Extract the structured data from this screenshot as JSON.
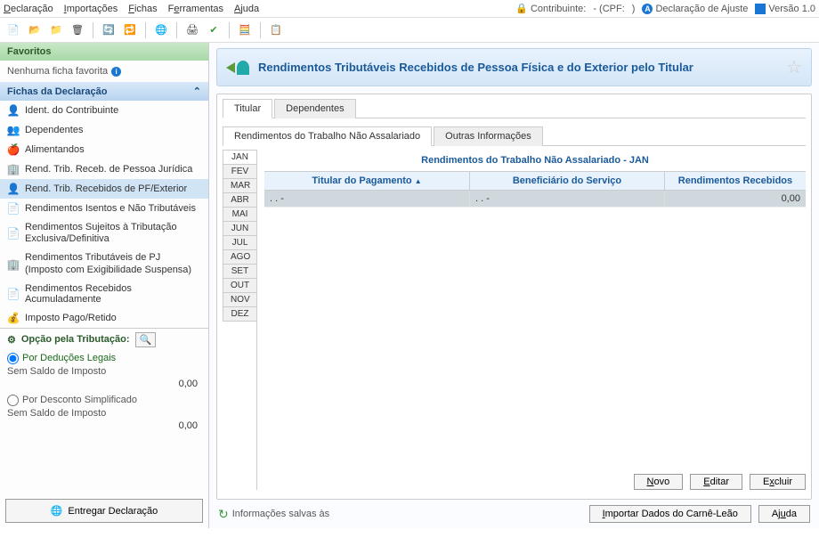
{
  "menu": {
    "declaracao": "Declaração",
    "importacoes": "Importações",
    "fichas": "Fichas",
    "ferramentas": "Ferramentas",
    "ajuda": "Ajuda"
  },
  "header_info": {
    "contribuinte_label": "Contribuinte:",
    "cpf_label": "- (CPF:",
    "cpf_close": ")",
    "decl_tipo": "Declaração de Ajuste",
    "versao": "Versão 1.0"
  },
  "favoritos": {
    "header": "Favoritos",
    "empty": "Nenhuma ficha favorita"
  },
  "fichas_header": "Fichas da Declaração",
  "fichas": [
    {
      "label": "Ident. do Contribuinte",
      "icon": "👤"
    },
    {
      "label": "Dependentes",
      "icon": "👥"
    },
    {
      "label": "Alimentandos",
      "icon": "🍎"
    },
    {
      "label": "Rend. Trib. Receb. de Pessoa Jurídica",
      "icon": "🏢"
    },
    {
      "label": "Rend. Trib. Recebidos de PF/Exterior",
      "icon": "👤"
    },
    {
      "label": "Rendimentos Isentos e Não Tributáveis",
      "icon": "📄"
    },
    {
      "label": "Rendimentos Sujeitos à Tributação Exclusiva/Definitiva",
      "icon": "📄"
    },
    {
      "label": "Rendimentos Tributáveis de PJ (Imposto com Exigibilidade Suspensa)",
      "icon": "🏢"
    },
    {
      "label": "Rendimentos Recebidos Acumuladamente",
      "icon": "📄"
    },
    {
      "label": "Imposto Pago/Retido",
      "icon": "💰"
    }
  ],
  "tributacao": {
    "header": "Opção pela Tributação:",
    "opt1": "Por Deduções Legais",
    "sub1": "Sem Saldo de Imposto",
    "val1": "0,00",
    "opt2": "Por Desconto Simplificado",
    "sub2": "Sem Saldo de Imposto",
    "val2": "0,00"
  },
  "entregar": "Entregar Declaração",
  "page_title": "Rendimentos Tributáveis Recebidos de Pessoa Física e do Exterior pelo Titular",
  "tabs1": {
    "titular": "Titular",
    "dependentes": "Dependentes"
  },
  "tabs2": {
    "nao_assal": "Rendimentos do Trabalho Não Assalariado",
    "outras": "Outras Informações"
  },
  "months": [
    "JAN",
    "FEV",
    "MAR",
    "ABR",
    "MAI",
    "JUN",
    "JUL",
    "AGO",
    "SET",
    "OUT",
    "NOV",
    "DEZ"
  ],
  "table": {
    "title": "Rendimentos do Trabalho Não Assalariado - JAN",
    "col1": "Titular do Pagamento",
    "col2": "Beneficiário do Serviço",
    "col3": "Rendimentos Recebidos",
    "row": {
      "c1": ". .  -",
      "c2": ". .  -",
      "c3": "0,00"
    }
  },
  "crud": {
    "novo": "Novo",
    "editar": "Editar",
    "excluir": "Excluir"
  },
  "footer": {
    "saved": "Informações salvas às",
    "importar": "Importar Dados do Carnê-Leão",
    "ajuda": "Ajuda"
  }
}
